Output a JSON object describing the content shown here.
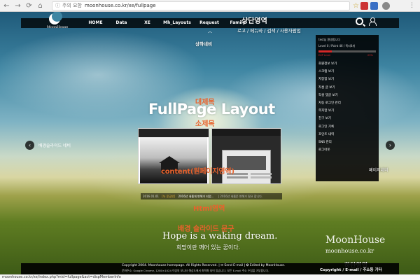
{
  "browser": {
    "secure_label": "주의 요함",
    "url": "moonhouse.co.kr/xe/fullpage"
  },
  "site": {
    "logo_text": "MoonHouse",
    "menu": [
      "HOME",
      "Data",
      "XE",
      "Mh_Layouts",
      "Request",
      "Family"
    ]
  },
  "annotations": {
    "top_region": "상단영역",
    "top_region_sub": "로고 / 메뉴바 / 검색 / 사용자팝업",
    "sub_nav": "상하네비",
    "big_heading": "대제목",
    "small_heading": "소제목",
    "content_area": "content(원페이지영역)",
    "bg_slide_nav": "배경슬라이드 네비",
    "page_nav": "페이지네비",
    "html_area": "Html영역",
    "bg_slide_text": "배경 슬라이드 문구",
    "bottom_region": "하단영역"
  },
  "hero": {
    "title": "FullPage Layout"
  },
  "user_panel": {
    "greeting": "test님 환영합니다",
    "level": "Level 0 / Point 46 / 쪽지0개",
    "exp_label": "EXP Level",
    "exp_percent": "23%",
    "exp_fraction": 0.23,
    "items": [
      "회원정보 보기",
      "스크랩 보기",
      "저장함 보기",
      "작성 글 보기",
      "작성 댓글 보기",
      "자동 로그인 관리",
      "쪽지함 보기",
      "친구 보기",
      "로그인 기록",
      "포인트 내역",
      "SNS 관리",
      "로그아웃"
    ]
  },
  "ticker": {
    "date": "2016.01.01",
    "tag": "[녹 운공안]",
    "text": "2016년 새롭게 변해가 되었...",
    "text2": "| 2016년 새롭운 변해가 필요 합니다."
  },
  "slogan": {
    "en": "Hope is a waking dream.",
    "ko": "희망이란 깨어 있는 꿈이다."
  },
  "brand": {
    "name": "MoonHouse",
    "url": "moonhouse.co.kr"
  },
  "footer": {
    "line1": "Copyright 2004. Moonhouse homepage. All Rights Reserved. | ✉ Send E-mail | ✪ Edited by MoonHouse.",
    "line2": "문화주소: Google Chrome, 1280×1024 이상의 모니터 해상도에서 최적화 되어 있습니다. 모든 E-mail 주소 수집을 거부합니다.",
    "right": "Copyright / E-mail / 주소등 기타"
  },
  "statusbar": {
    "url": "moonhouse.co.kr/xe/index.php?mid=fullpage&act=dispMemberInfo"
  }
}
